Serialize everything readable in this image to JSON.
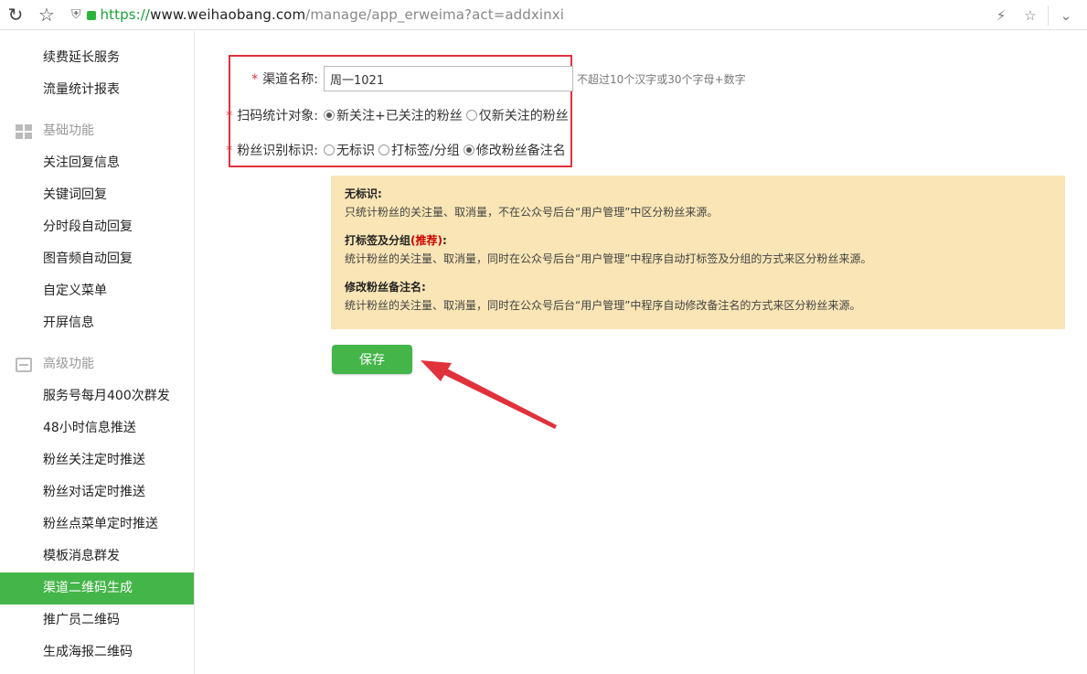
{
  "browser": {
    "url_scheme": "https://",
    "url_host": "www.weihaobang.com",
    "url_path": "/manage/app_erweima?act=addxinxi"
  },
  "sidebar": {
    "items_top": [
      {
        "label": "续费延长服务"
      },
      {
        "label": "流量统计报表"
      }
    ],
    "group_basic": {
      "label": "基础功能",
      "icon": "grid-icon"
    },
    "items_basic": [
      {
        "label": "关注回复信息"
      },
      {
        "label": "关键词回复"
      },
      {
        "label": "分时段自动回复"
      },
      {
        "label": "图音频自动回复"
      },
      {
        "label": "自定义菜单"
      },
      {
        "label": "开屏信息"
      }
    ],
    "group_advanced": {
      "label": "高级功能",
      "icon": "tray-icon"
    },
    "items_advanced": [
      {
        "label": "服务号每月400次群发"
      },
      {
        "label": "48小时信息推送"
      },
      {
        "label": "粉丝关注定时推送"
      },
      {
        "label": "粉丝对话定时推送"
      },
      {
        "label": "粉丝点菜单定时推送"
      },
      {
        "label": "模板消息群发"
      },
      {
        "label": "渠道二维码生成",
        "active": true
      },
      {
        "label": "推广员二维码"
      },
      {
        "label": "生成海报二维码"
      }
    ],
    "active_color": "#44b549"
  },
  "form": {
    "required_mark": "*",
    "channel_name": {
      "label": "渠道名称:",
      "value": "周一1021",
      "hint": "不超过10个汉字或30个字母+数字"
    },
    "scan_target": {
      "label": "扫码统计对象:",
      "options": [
        {
          "label": "新关注+已关注的粉丝",
          "checked": true
        },
        {
          "label": "仅新关注的粉丝",
          "checked": false
        }
      ]
    },
    "fan_tag": {
      "label": "粉丝识别标识:",
      "options": [
        {
          "label": "无标识",
          "checked": false
        },
        {
          "label": "打标签/分组",
          "checked": false
        },
        {
          "label": "修改粉丝备注名",
          "checked": true
        }
      ]
    }
  },
  "note": {
    "s1_title": "无标识:",
    "s1_text": "只统计粉丝的关注量、取消量，不在公众号后台“用户管理”中区分粉丝来源。",
    "s2_title": "打标签及分组",
    "s2_recommend": "(推荐)",
    "s2_colon": ":",
    "s2_text": "统计粉丝的关注量、取消量，同时在公众号后台“用户管理”中程序自动打标签及分组的方式来区分粉丝来源。",
    "s3_title": "修改粉丝备注名:",
    "s3_text": "统计粉丝的关注量、取消量，同时在公众号后台“用户管理”中程序自动修改备注名的方式来区分粉丝来源。",
    "bg_color": "#f9e5b5"
  },
  "save_label": "保存",
  "highlight_color": "#e0323b"
}
